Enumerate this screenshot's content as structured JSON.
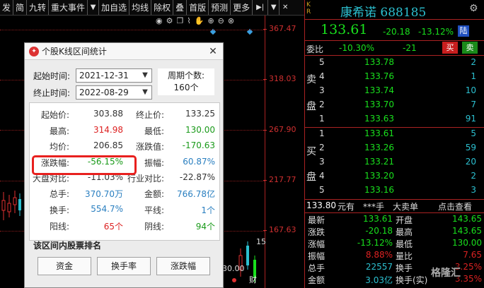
{
  "toolbar": {
    "items": [
      "发",
      "简",
      "九转",
      "重大事件",
      "加自选",
      "均线",
      "除权",
      "叠",
      "首版",
      "预测",
      "更多"
    ],
    "dropdown_glyph": "▼",
    "nav_glyph": "▶|",
    "close_glyph": "✕"
  },
  "chart": {
    "price_labels": [
      "367.47",
      "318.03",
      "267.90",
      "217.77",
      "167.63"
    ],
    "bottom_text": "30.00",
    "side_number": "15",
    "bottom_char": "财",
    "axis_color": "#aa2222"
  },
  "dialog": {
    "title": "个股K线区间统计",
    "close_glyph": "✕",
    "start_label": "起始时间:",
    "start_value": "2021-12-31",
    "end_label": "终止时间:",
    "end_value": "2022-08-29",
    "period_label": "周期个数:",
    "period_value": "160个",
    "stats": {
      "open_label": "起始价:",
      "open_value": "303.88",
      "close_label": "终止价:",
      "close_value": "133.25",
      "high_label": "最高:",
      "high_value": "314.98",
      "low_label": "最低:",
      "low_value": "130.00",
      "avg_label": "均价:",
      "avg_value": "206.85",
      "change_value_label": "涨跌值:",
      "change_value": "-170.63",
      "change_pct_label": "涨跌幅:",
      "change_pct": "-56.15%",
      "amplitude_label": "振幅:",
      "amplitude": "60.87%",
      "market_vs_label": "大盘对比:",
      "market_vs": "-11.03%",
      "industry_vs_label": "行业对比:",
      "industry_vs": "-22.87%",
      "volume_label": "总手:",
      "volume": "370.70万",
      "amount_label": "金额:",
      "amount": "766.78亿",
      "turnover_label": "换手:",
      "turnover": "554.7%",
      "flat_label": "平线:",
      "flat": "1个",
      "up_label": "阳线:",
      "up": "65个",
      "down_label": "阴线:",
      "down": "94个"
    },
    "ranking_label": "该区间内股票排名",
    "buttons": [
      "资金",
      "换手率",
      "涨跌幅"
    ]
  },
  "quote": {
    "kr": [
      "K",
      "R"
    ],
    "name": "康希诺 688185",
    "price": "133.61",
    "change": "-20.18",
    "change_pct": "-13.12%",
    "board_tag": "陆",
    "weibi_label": "委比",
    "weibi_pct": "-10.30%",
    "weibi_diff": "-21",
    "buy_btn": "买",
    "sell_btn": "卖",
    "sell_side_label": [
      "卖",
      "盘"
    ],
    "buy_side_label": [
      "买",
      "盘"
    ],
    "sell_orders": [
      {
        "level": "5",
        "price": "133.78",
        "vol": "2"
      },
      {
        "level": "4",
        "price": "133.76",
        "vol": "1"
      },
      {
        "level": "3",
        "price": "133.74",
        "vol": "10"
      },
      {
        "level": "2",
        "price": "133.70",
        "vol": "7"
      },
      {
        "level": "1",
        "price": "133.63",
        "vol": "91"
      }
    ],
    "buy_orders": [
      {
        "level": "1",
        "price": "133.61",
        "vol": "5"
      },
      {
        "level": "2",
        "price": "133.26",
        "vol": "59"
      },
      {
        "level": "3",
        "price": "133.21",
        "vol": "20"
      },
      {
        "level": "4",
        "price": "133.20",
        "vol": "2"
      },
      {
        "level": "5",
        "price": "133.16",
        "vol": "3"
      }
    ],
    "info_bar": {
      "price": "133.80",
      "unit": "元有",
      "stars": "***手",
      "action": "大卖单",
      "link": "点击查看"
    },
    "rows": [
      {
        "k": "最新",
        "v": "133.61",
        "k2": "开盘",
        "v2": "143.65"
      },
      {
        "k": "涨跌",
        "v": "-20.18",
        "k2": "最高",
        "v2": "143.65"
      },
      {
        "k": "涨幅",
        "v": "-13.12%",
        "k2": "最低",
        "v2": "130.00"
      },
      {
        "k": "振幅",
        "v": "8.88%",
        "k2": "量比",
        "v2": "7.65"
      },
      {
        "k": "总手",
        "v": "22557",
        "k2": "换手",
        "v2": "3.25%"
      },
      {
        "k": "金额",
        "v": "3.03亿",
        "k2": "换手(实)",
        "v2": "3.35%"
      }
    ],
    "watermark": "格隆汇"
  }
}
